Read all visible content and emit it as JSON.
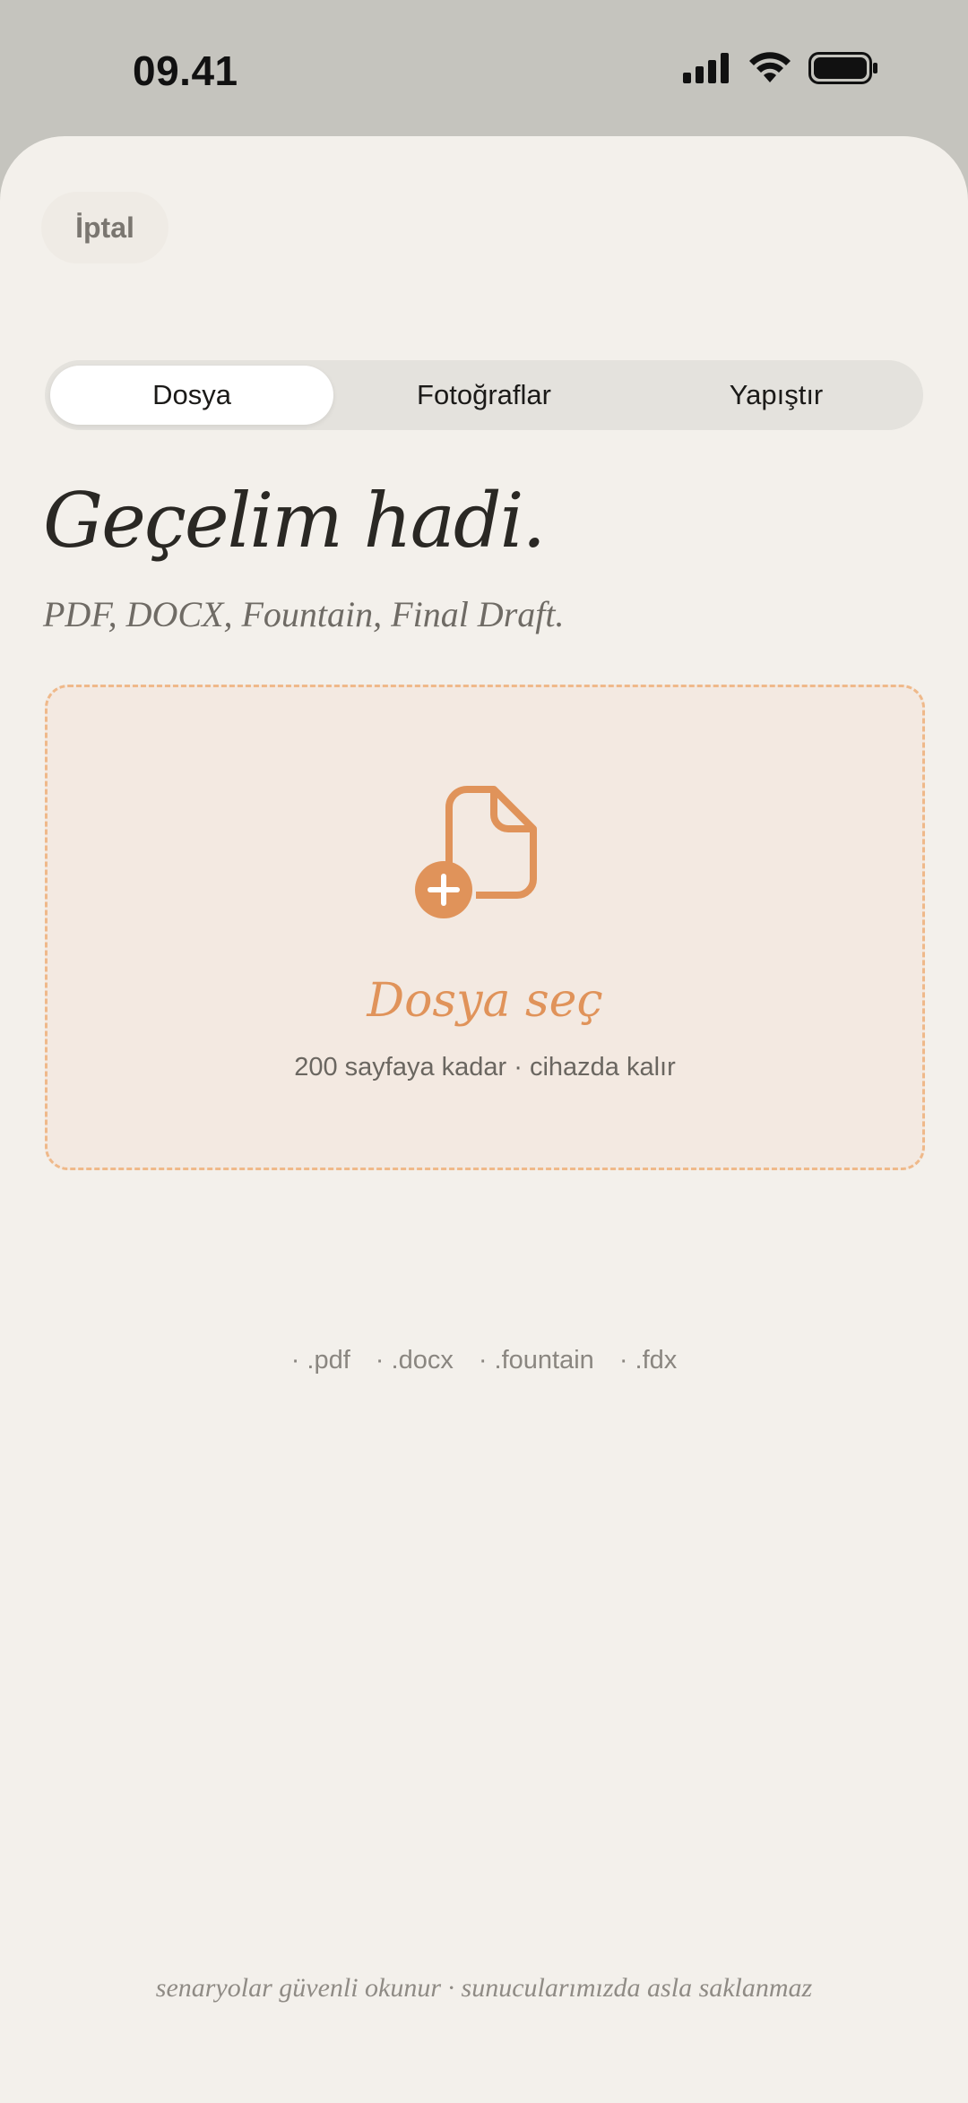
{
  "status_bar": {
    "time": "09.41",
    "icons": [
      "cellular-signal-icon",
      "wifi-icon",
      "battery-icon"
    ]
  },
  "header": {
    "cancel_label": "İptal"
  },
  "tabs": [
    {
      "label": "Dosya",
      "selected": true
    },
    {
      "label": "Fotoğraflar",
      "selected": false
    },
    {
      "label": "Yapıştır",
      "selected": false
    }
  ],
  "main": {
    "title": "Geçelim hadi.",
    "subtitle": "PDF, DOCX, Fountain, Final Draft."
  },
  "dropzone": {
    "icon": "file-add-icon",
    "title": "Dosya seç",
    "subtitle": "200 sayfaya kadar · cihazda kalır"
  },
  "formats": [
    "· .pdf",
    "· .docx",
    "· .fountain",
    "· .fdx"
  ],
  "footer": {
    "note": "senaryolar güvenli okunur · sunucularımızda asla saklanmaz"
  },
  "colors": {
    "accent": "#e0935a",
    "background": "#f3f0eb",
    "dropzone_border": "#efb98a",
    "dropzone_fill": "#f3e9e1"
  }
}
